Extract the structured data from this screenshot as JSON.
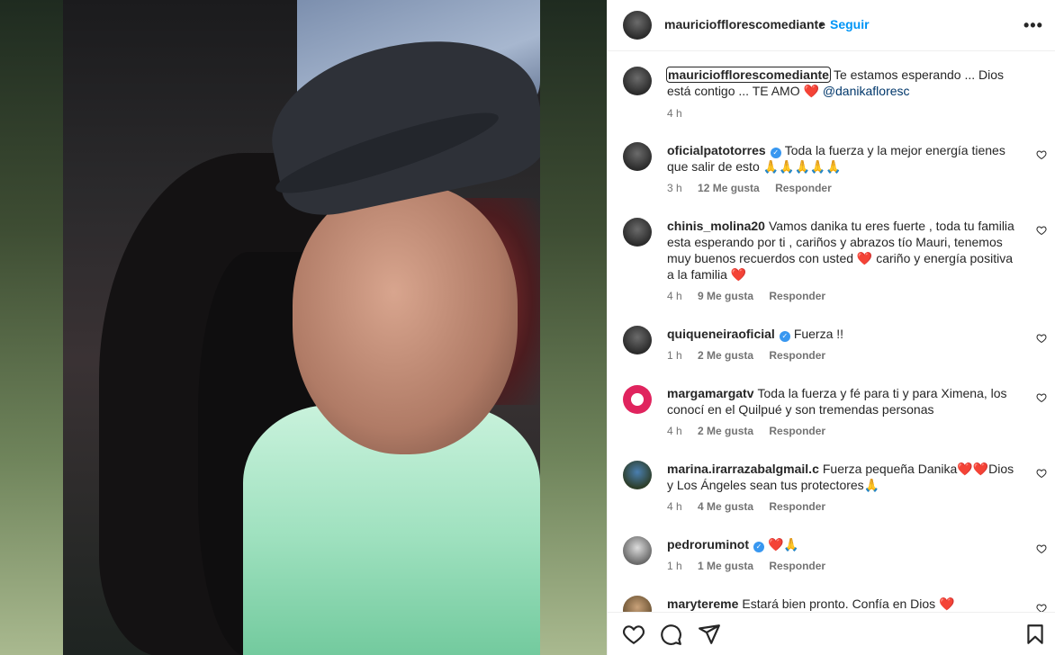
{
  "post": {
    "author": "mauriciofflorescomediante",
    "follow_label": "Seguir",
    "dot": "•",
    "more": "•••"
  },
  "caption": {
    "username": "mauriciofflorescomediante",
    "text": "Te estamos esperando ... Dios está contigo ... TE AMO",
    "heart": "❤️",
    "mention": "@danikafloresc",
    "time": "4 h"
  },
  "comments": [
    {
      "username": "oficialpatotorres",
      "verified": true,
      "text": "Toda la fuerza y la mejor energía tienes que salir de esto 🙏🙏🙏🙏🙏",
      "time": "3 h",
      "likes": "12 Me gusta",
      "reply": "Responder"
    },
    {
      "username": "chinis_molina20",
      "verified": false,
      "text": "Vamos danika tu eres fuerte , toda tu familia esta esperando por ti , cariños y abrazos tío Mauri, tenemos muy buenos recuerdos con usted ❤️ cariño y energía positiva a la familia ❤️",
      "time": "4 h",
      "likes": "9 Me gusta",
      "reply": "Responder"
    },
    {
      "username": "quiqueneiraoficial",
      "verified": true,
      "text": "Fuerza !!",
      "time": "1 h",
      "likes": "2 Me gusta",
      "reply": "Responder"
    },
    {
      "username": "margamargatv",
      "verified": false,
      "text": "Toda la fuerza y fé para ti y para Ximena, los conocí en el Quilpué y son tremendas personas",
      "time": "4 h",
      "likes": "2 Me gusta",
      "reply": "Responder"
    },
    {
      "username": "marina.irarrazabalgmail.c",
      "verified": false,
      "text": "Fuerza pequeña Danika❤️❤️Dios y Los Ángeles sean tus protectores🙏",
      "time": "4 h",
      "likes": "4 Me gusta",
      "reply": "Responder"
    },
    {
      "username": "pedroruminot",
      "verified": true,
      "text": "❤️🙏",
      "time": "1 h",
      "likes": "1 Me gusta",
      "reply": "Responder"
    },
    {
      "username": "marytereme",
      "verified": false,
      "text": "Estará bien pronto. Confía en Dios ❤️",
      "time": "",
      "likes": "",
      "reply": ""
    }
  ],
  "icons": {
    "like": "heart-icon",
    "comment": "comment-icon",
    "share": "send-icon",
    "save": "bookmark-icon"
  },
  "colors": {
    "accent": "#0095f6",
    "text": "#262626",
    "muted": "#737373",
    "heart": "#ed4956",
    "verified": "#3897f0"
  }
}
